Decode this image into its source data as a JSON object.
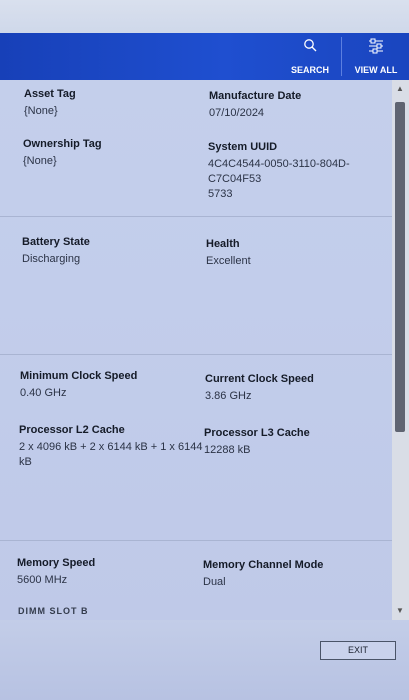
{
  "header": {
    "search_label": "SEARCH",
    "viewall_label": "VIEW ALL"
  },
  "fields": {
    "asset_tag": {
      "label": "Asset Tag",
      "value": "{None}"
    },
    "manufacture_date": {
      "label": "Manufacture Date",
      "value": "07/10/2024"
    },
    "ownership_tag": {
      "label": "Ownership Tag",
      "value": "{None}"
    },
    "system_uuid": {
      "label": "System UUID",
      "value_line1": "4C4C4544-0050-3110-804D-C7C04F53",
      "value_line2": "5733"
    },
    "battery_state": {
      "label": "Battery State",
      "value": "Discharging"
    },
    "health": {
      "label": "Health",
      "value": "Excellent"
    },
    "min_clock": {
      "label": "Minimum Clock Speed",
      "value": "0.40 GHz"
    },
    "current_clock": {
      "label": "Current Clock Speed",
      "value": "3.86 GHz"
    },
    "l2_cache": {
      "label": "Processor L2 Cache",
      "value_line1": "2 x 4096  kB + 2 x 6144  kB + 1 x 6144",
      "value_line2": "kB"
    },
    "l3_cache": {
      "label": "Processor L3 Cache",
      "value": "12288 kB"
    },
    "memory_speed": {
      "label": "Memory Speed",
      "value": "5600 MHz"
    },
    "memory_channel": {
      "label": "Memory Channel Mode",
      "value": "Dual"
    },
    "cutoff": "DIMM SLOT B"
  },
  "footer": {
    "exit_label": "EXIT"
  }
}
